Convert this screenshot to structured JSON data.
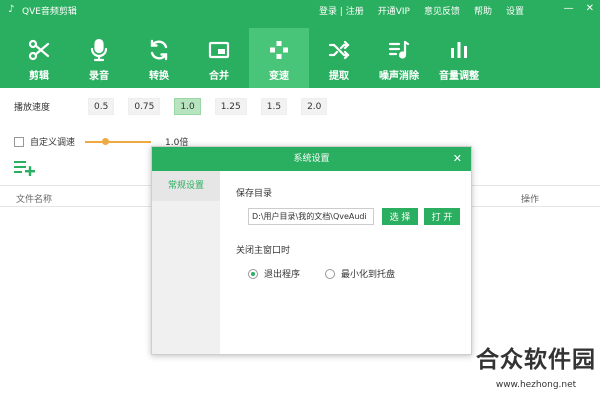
{
  "app": {
    "title": "QVE音频剪辑",
    "top_links": [
      "登录 | 注册",
      "开通VIP",
      "意见反馈",
      "帮助",
      "设置"
    ],
    "win_controls": [
      "—",
      "✕"
    ]
  },
  "toolbar": [
    {
      "label": "剪辑",
      "icon": "scissors-icon",
      "active": false
    },
    {
      "label": "录音",
      "icon": "microphone-icon",
      "active": false
    },
    {
      "label": "转换",
      "icon": "convert-icon",
      "active": false
    },
    {
      "label": "合并",
      "icon": "merge-icon",
      "active": false
    },
    {
      "label": "变速",
      "icon": "speed-icon",
      "active": true
    },
    {
      "label": "提取",
      "icon": "shuffle-icon",
      "active": false
    },
    {
      "label": "噪声消除",
      "icon": "music-note-icon",
      "active": false
    },
    {
      "label": "音量调整",
      "icon": "bars-icon",
      "active": false
    }
  ],
  "speed": {
    "label": "播放速度",
    "options": [
      "0.5",
      "0.75",
      "1.0",
      "1.25",
      "1.5",
      "2.0"
    ],
    "selected": "1.0"
  },
  "custom_speed": {
    "label": "自定义调速",
    "checked": false,
    "value_text": "1.0倍",
    "slider_fraction": 0.28
  },
  "file_list": {
    "col_name": "文件名称",
    "col_op": "操作"
  },
  "dialog": {
    "title": "系统设置",
    "close_glyph": "✕",
    "tab": "常规设置",
    "save_label": "保存目录",
    "save_path": "D:\\用户目录\\我的文档\\QveAudi",
    "choose_button": "选 择",
    "open_button": "打 开",
    "close_label": "关闭主窗口时",
    "options": [
      {
        "label": "退出程序",
        "selected": true
      },
      {
        "label": "最小化到托盘",
        "selected": false
      }
    ]
  },
  "watermark": {
    "cn": "合众软件园",
    "url": "www.hezhong.net"
  },
  "colors": {
    "brand_green": "#2aae5f",
    "slider_orange": "#f0a840",
    "selected_speed_bg": "#b7e3be"
  }
}
